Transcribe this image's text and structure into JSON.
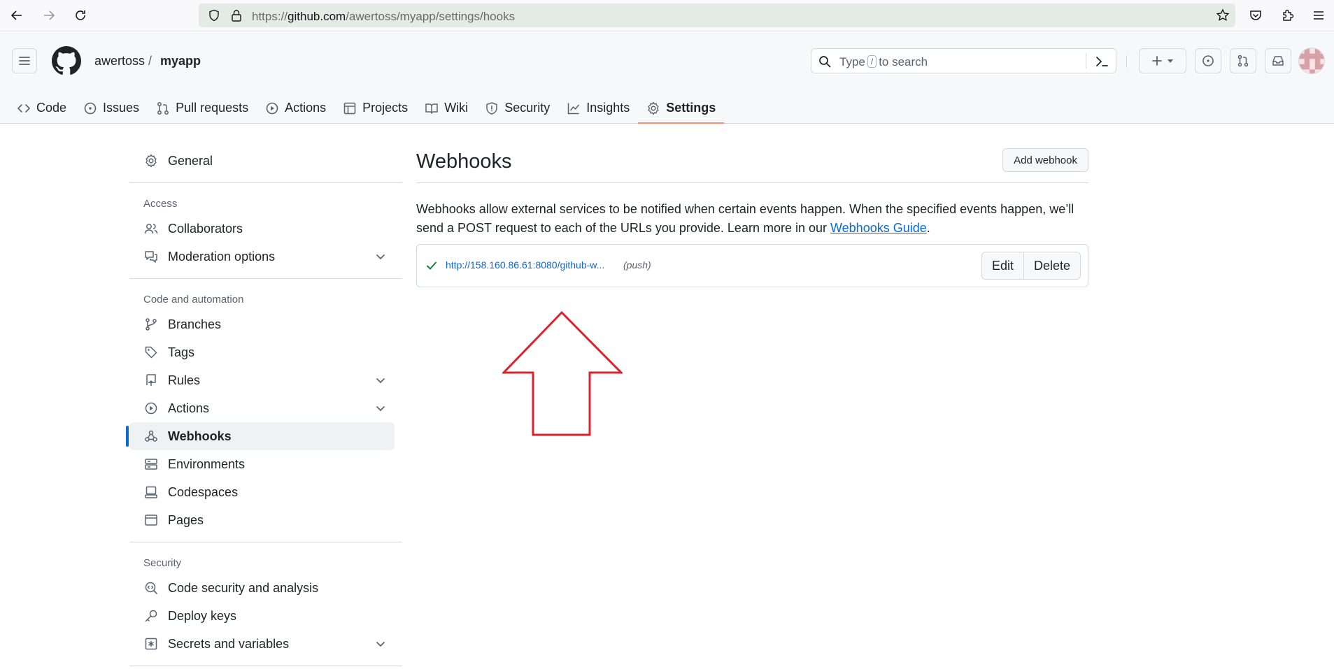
{
  "browser": {
    "url_prefix": "https://",
    "url_host": "github.com",
    "url_path": "/awertoss/myapp/settings/hooks"
  },
  "header": {
    "owner": "awertoss",
    "separator": "/",
    "repo": "myapp",
    "search_prefix": "Type",
    "search_key": "/",
    "search_suffix": "to search"
  },
  "repo_nav": {
    "tabs": [
      {
        "label": "Code",
        "icon": "code-icon"
      },
      {
        "label": "Issues",
        "icon": "issue-opened-icon"
      },
      {
        "label": "Pull requests",
        "icon": "git-pull-request-icon"
      },
      {
        "label": "Actions",
        "icon": "play-icon"
      },
      {
        "label": "Projects",
        "icon": "table-icon"
      },
      {
        "label": "Wiki",
        "icon": "book-icon"
      },
      {
        "label": "Security",
        "icon": "shield-icon"
      },
      {
        "label": "Insights",
        "icon": "graph-icon"
      },
      {
        "label": "Settings",
        "icon": "gear-icon"
      }
    ],
    "selected": "Settings"
  },
  "sidebar": {
    "general": "General",
    "access_heading": "Access",
    "collaborators": "Collaborators",
    "moderation": "Moderation options",
    "code_heading": "Code and automation",
    "branches": "Branches",
    "tags": "Tags",
    "rules": "Rules",
    "actions": "Actions",
    "webhooks": "Webhooks",
    "environments": "Environments",
    "codespaces": "Codespaces",
    "pages": "Pages",
    "security_heading": "Security",
    "code_security": "Code security and analysis",
    "deploy_keys": "Deploy keys",
    "secrets": "Secrets and variables"
  },
  "main": {
    "title": "Webhooks",
    "add_button": "Add webhook",
    "description_text": "Webhooks allow external services to be notified when certain events happen. When the specified events happen, we’ll send a POST request to each of the URLs you provide. Learn more in our ",
    "description_link": "Webhooks Guide",
    "description_end": ".",
    "hook": {
      "url": "http://158.160.86.61:8080/github-w...",
      "events": "(push)",
      "status": "success",
      "edit_label": "Edit",
      "delete_label": "Delete"
    }
  },
  "colors": {
    "accent": "#0969da",
    "selected_tab_underline": "#fd8c73",
    "success": "#1a7f37",
    "annotation_arrow": "#d9232e"
  }
}
